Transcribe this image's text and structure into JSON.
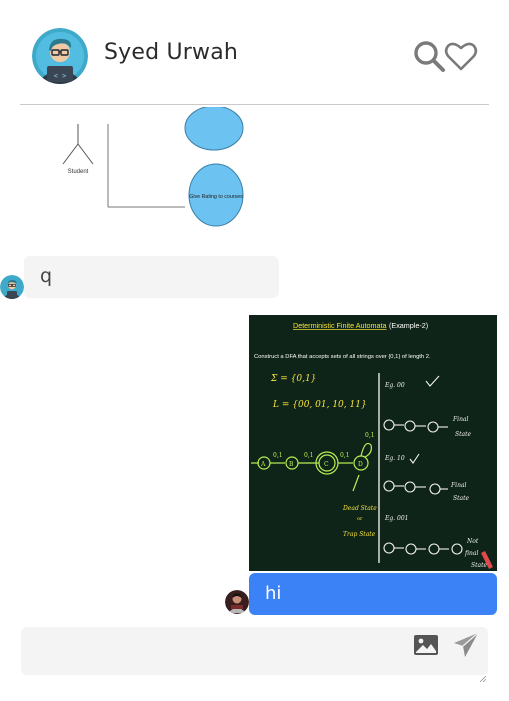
{
  "header": {
    "contact_name": "Syed Urwah",
    "avatar_icon": "coder-avatar-icon",
    "search_icon": "search-icon",
    "favorite_icon": "heart-icon"
  },
  "messages": [
    {
      "type": "image",
      "direction": "incoming",
      "content": {
        "actor_label": "Student",
        "usecase_label": "Give Rating to courses"
      }
    },
    {
      "type": "text",
      "direction": "incoming",
      "text": "q"
    },
    {
      "type": "image",
      "direction": "outgoing",
      "content": {
        "title": "Deterministic Finite Automata",
        "subtitle": "(Example-2)",
        "question": "Construct a DFA that accepts sets of all strings over {0,1} of length 2.",
        "sigma": "Σ = {0,1}",
        "language": "L = {00, 01, 10, 11}",
        "dead_state_label": "Dead State",
        "trap_state_label": "Trap State",
        "final_label": "Final State",
        "examples": [
          "Eg. 00",
          "Eg. 10",
          "Eg. 001"
        ]
      }
    },
    {
      "type": "text",
      "direction": "outgoing",
      "text": "hi"
    }
  ],
  "composer": {
    "placeholder": "",
    "image_icon": "image-icon",
    "send_icon": "send-icon"
  },
  "colors": {
    "outgoing_bubble": "#3b82f6",
    "incoming_bubble": "#f4f4f4",
    "divider": "#c9c9c9",
    "icon_gray": "#7a7a7a"
  }
}
